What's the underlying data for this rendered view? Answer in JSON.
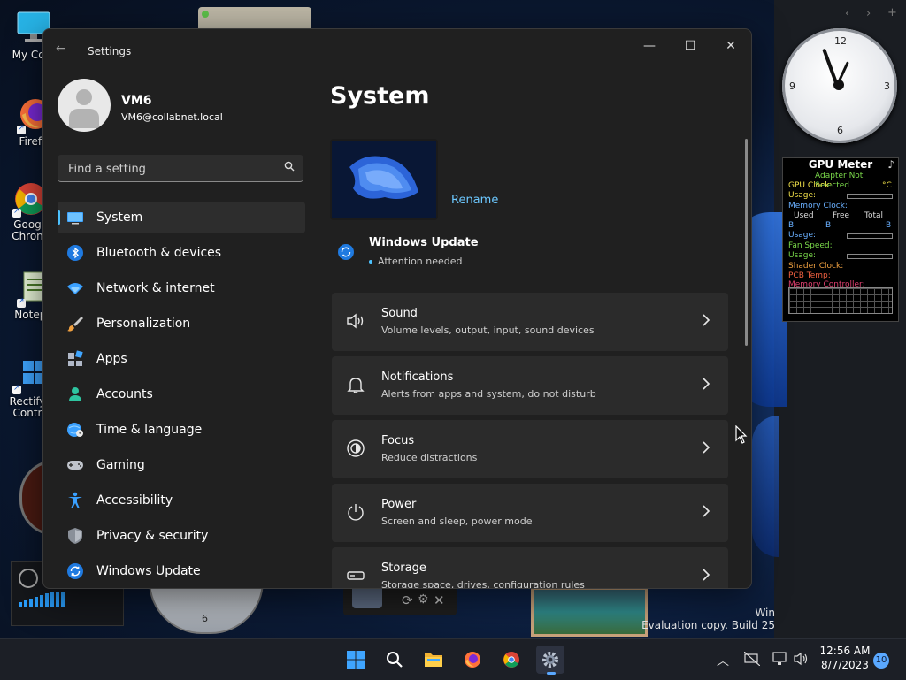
{
  "desktop": {
    "icons": [
      {
        "label": "My Com",
        "name": "my-computer"
      },
      {
        "label": "Firefo",
        "name": "firefox"
      },
      {
        "label": "Goog Chron",
        "name": "google-chrome"
      },
      {
        "label": "Notepa",
        "name": "notepad"
      },
      {
        "label": "Rectify Contr",
        "name": "rectify-control"
      }
    ],
    "watermark": {
      "line1": "Win",
      "line2": "Evaluation copy. Build 25"
    }
  },
  "widgets": {
    "clock_numbers": [
      "12",
      "3",
      "6",
      "9"
    ],
    "gpu": {
      "title": "GPU Meter",
      "adapter": "Adapter Not Selected",
      "gpu_clock": "GPU Clock:",
      "unit": "°C",
      "usage1": "Usage:",
      "memory_clock": "Memory Clock:",
      "used": "Used",
      "free": "Free",
      "total": "Total",
      "b1": "B",
      "b2": "B",
      "b3": "B",
      "usage2": "Usage:",
      "fan_speed": "Fan Speed:",
      "usage3": "Usage:",
      "shader": "Shader Clock:",
      "pcb": "PCB Temp:",
      "mem_ctrl": "Memory Controller:"
    },
    "bottom_gauge_number": "6"
  },
  "window": {
    "title": "Settings",
    "controls": {
      "minimize": "—",
      "maximize": "☐",
      "close": "✕"
    },
    "back_glyph": "←"
  },
  "profile": {
    "name": "VM6",
    "email": "VM6@collabnet.local"
  },
  "search": {
    "placeholder": "Find a setting"
  },
  "nav": [
    {
      "label": "System",
      "icon": "system-icon",
      "selected": true
    },
    {
      "label": "Bluetooth & devices",
      "icon": "bluetooth-icon"
    },
    {
      "label": "Network & internet",
      "icon": "wifi-icon"
    },
    {
      "label": "Personalization",
      "icon": "brush-icon"
    },
    {
      "label": "Apps",
      "icon": "apps-icon"
    },
    {
      "label": "Accounts",
      "icon": "accounts-icon"
    },
    {
      "label": "Time & language",
      "icon": "globe-clock-icon"
    },
    {
      "label": "Gaming",
      "icon": "gamepad-icon"
    },
    {
      "label": "Accessibility",
      "icon": "accessibility-icon"
    },
    {
      "label": "Privacy & security",
      "icon": "shield-icon"
    },
    {
      "label": "Windows Update",
      "icon": "windows-update-icon"
    }
  ],
  "main": {
    "title": "System",
    "rename": "Rename",
    "windows_update": {
      "title": "Windows Update",
      "status": "Attention needed"
    },
    "cards": [
      {
        "title": "Sound",
        "desc": "Volume levels, output, input, sound devices",
        "icon": "speaker-icon"
      },
      {
        "title": "Notifications",
        "desc": "Alerts from apps and system, do not disturb",
        "icon": "bell-icon"
      },
      {
        "title": "Focus",
        "desc": "Reduce distractions",
        "icon": "focus-icon"
      },
      {
        "title": "Power",
        "desc": "Screen and sleep, power mode",
        "icon": "power-icon"
      },
      {
        "title": "Storage",
        "desc": "Storage space, drives, configuration rules",
        "icon": "storage-icon"
      }
    ]
  },
  "taskbar": {
    "time": "12:56 AM",
    "date": "8/7/2023",
    "notification_count": "10"
  }
}
